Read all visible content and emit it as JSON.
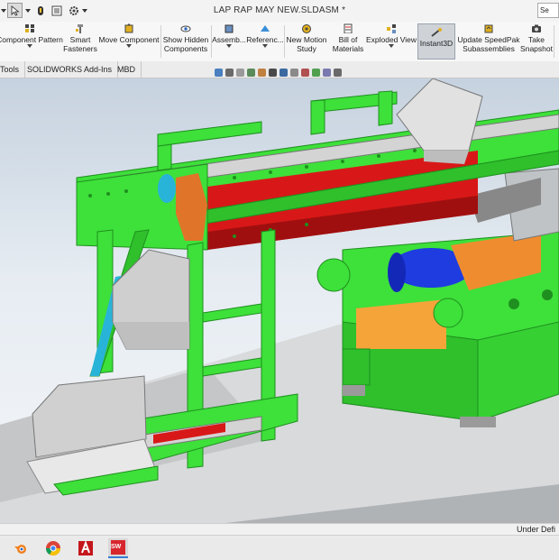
{
  "window": {
    "title": "LAP RAP MAY NEW.SLDASM *"
  },
  "search": {
    "placeholder": "Se"
  },
  "ribbon": {
    "buttons": [
      {
        "label": "Component Pattern",
        "icon": "component-pattern-icon"
      },
      {
        "label": "Smart\nFasteners",
        "icon": "smart-fasteners-icon"
      },
      {
        "label": "Move Component",
        "icon": "move-component-icon"
      },
      {
        "label": "Show Hidden\nComponents",
        "icon": "show-hidden-icon"
      },
      {
        "label": "Assemb...",
        "icon": "assembly-features-icon"
      },
      {
        "label": "Referenc...",
        "icon": "reference-geometry-icon"
      },
      {
        "label": "New Motion\nStudy",
        "icon": "motion-study-icon"
      },
      {
        "label": "Bill of\nMaterials",
        "icon": "bill-of-materials-icon"
      },
      {
        "label": "Exploded View",
        "icon": "exploded-view-icon"
      },
      {
        "label": "Instant3D",
        "icon": "instant3d-icon"
      },
      {
        "label": "Update SpeedPak\nSubassemblies",
        "icon": "speedpak-icon"
      },
      {
        "label": "Take\nSnapshot",
        "icon": "camera-icon"
      }
    ]
  },
  "tabs": [
    {
      "label": "Tools"
    },
    {
      "label": "SOLIDWORKS Add-Ins"
    },
    {
      "label": "MBD"
    }
  ],
  "status": {
    "text": "Under Defi"
  },
  "taskbar": {
    "apps": [
      {
        "name": "blender-icon"
      },
      {
        "name": "chrome-icon"
      },
      {
        "name": "autocad-icon"
      },
      {
        "name": "solidworks-icon",
        "label": "SW"
      }
    ]
  },
  "colors": {
    "frame": "#3ee03a",
    "guard": "#c9c9c9",
    "belt_red": "#d81818",
    "roller_blue": "#1428e8",
    "orange": "#f0a030",
    "floor": "#b0b3b6"
  }
}
